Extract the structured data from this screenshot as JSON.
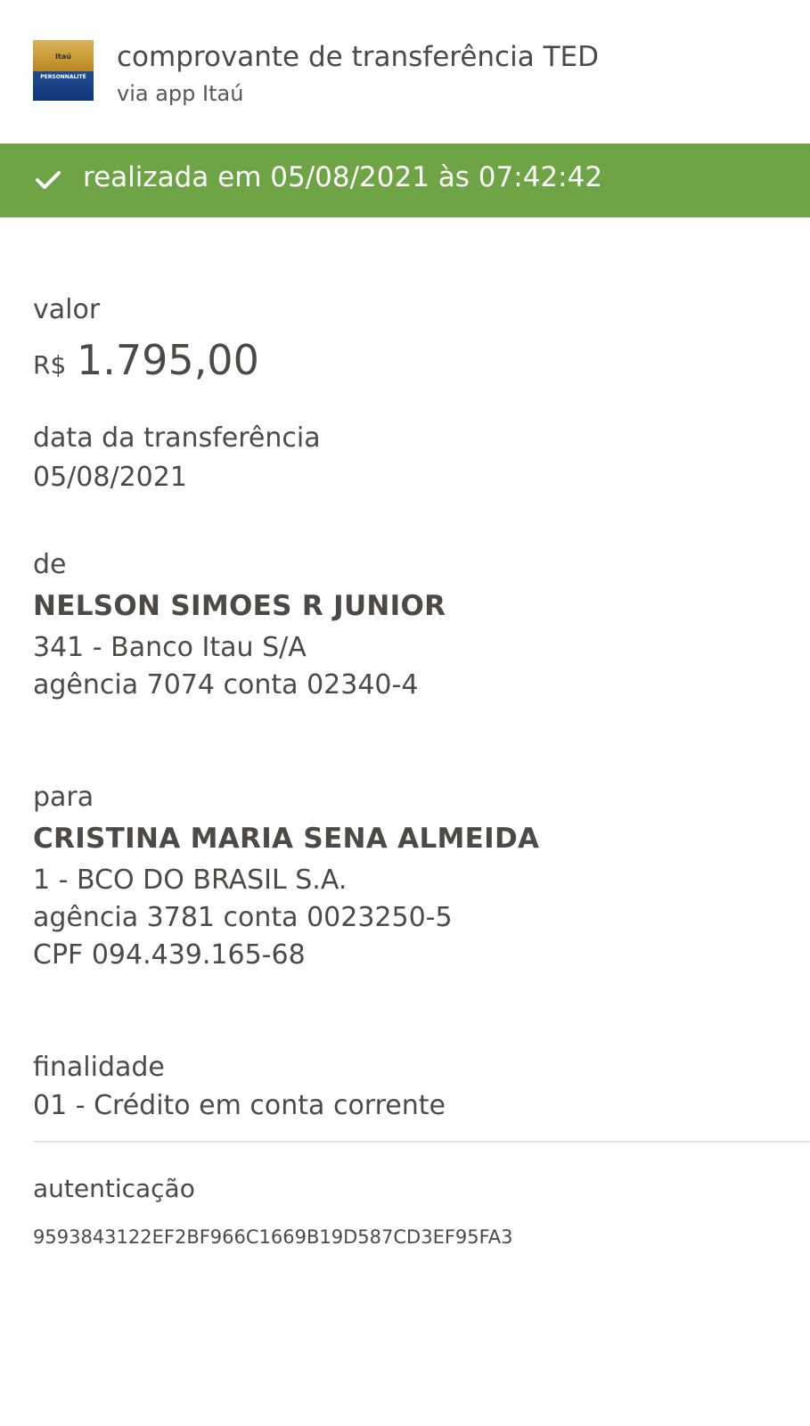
{
  "header": {
    "logo_brand": "Itaú",
    "logo_sub": "PERSONNALITÉ",
    "title": "comprovante de transferência TED",
    "subtitle": "via app Itaú"
  },
  "status": {
    "icon": "check-icon",
    "text": "realizada em 05/08/2021 às 07:42:42",
    "color": "#6ea346"
  },
  "valor": {
    "label": "valor",
    "currency": "R$",
    "amount": "1.795,00"
  },
  "data_transferencia": {
    "label": "data da transferência",
    "value": "05/08/2021"
  },
  "de": {
    "label": "de",
    "name": "NELSON SIMOES R JUNIOR",
    "bank": "341 - Banco Itau S/A",
    "account": "agência 7074 conta 02340-4"
  },
  "para": {
    "label": "para",
    "name": "CRISTINA MARIA SENA ALMEIDA",
    "bank": "1 - BCO DO BRASIL S.A.",
    "account": "agência 3781 conta 0023250-5",
    "cpf": "CPF 094.439.165-68"
  },
  "finalidade": {
    "label": "finalidade",
    "value": "01 - Crédito em conta corrente"
  },
  "autenticacao": {
    "label": "autenticação",
    "code": "9593843122EF2BF966C1669B19D587CD3EF95FA3"
  }
}
